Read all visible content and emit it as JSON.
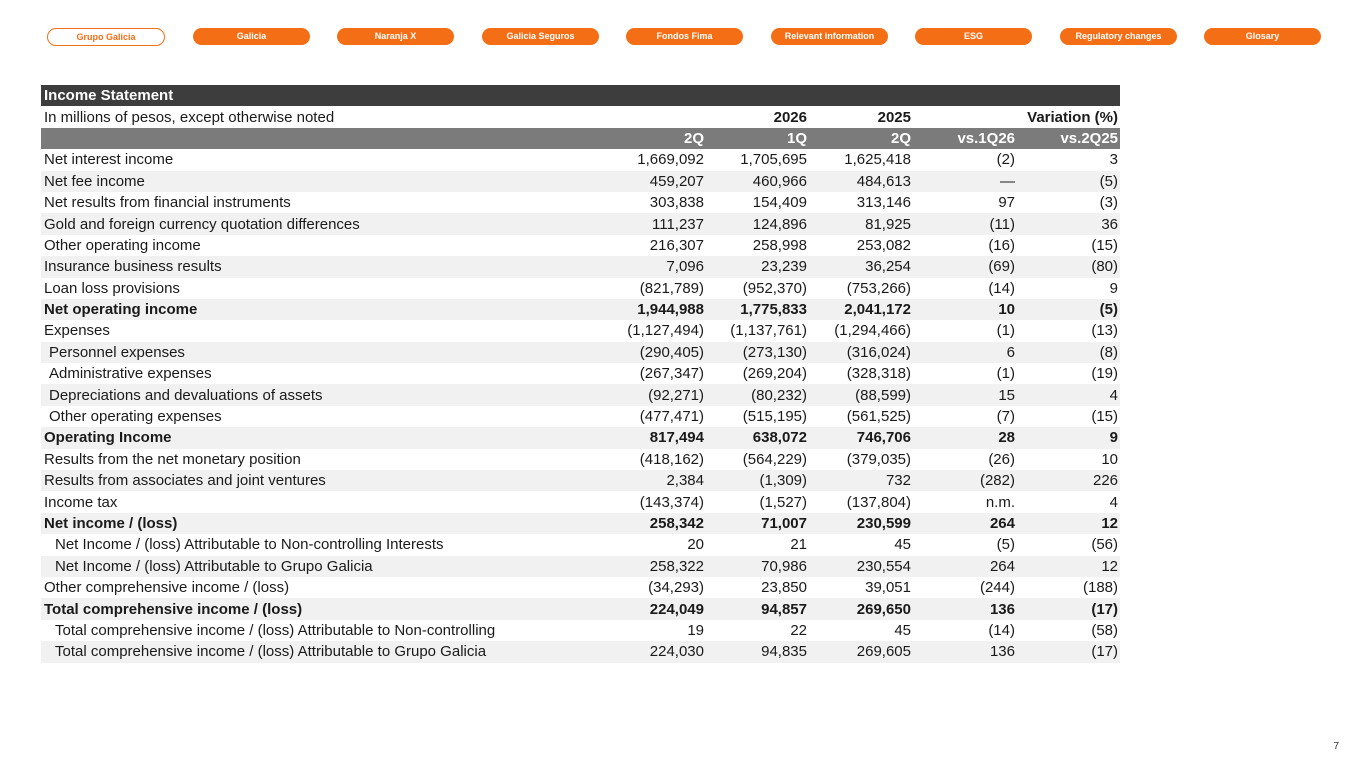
{
  "nav": {
    "items": [
      {
        "label": "Grupo Galicia",
        "active": true
      },
      {
        "label": "Galicia",
        "active": false
      },
      {
        "label": "Naranja X",
        "active": false
      },
      {
        "label": "Galicia Seguros",
        "active": false
      },
      {
        "label": "Fondos Fima",
        "active": false
      },
      {
        "label": "Relevant information",
        "active": false
      },
      {
        "label": "ESG",
        "active": false
      },
      {
        "label": "Regulatory changes",
        "active": false
      },
      {
        "label": "Glosary",
        "active": false
      }
    ]
  },
  "colors": {
    "accent": "#f46e16",
    "header_dark": "#3d3d3d",
    "header_mid": "#7b7b7b",
    "row_shade": "#f1f1f1"
  },
  "table": {
    "title": "Income Statement",
    "subtitle": "In millions of pesos, except otherwise noted",
    "years": [
      "2026",
      "2025"
    ],
    "variation_label": "Variation (%)",
    "columns": [
      "2Q",
      "1Q",
      "2Q",
      "vs.1Q26",
      "vs.2Q25"
    ],
    "rows": [
      {
        "label": "Net interest income",
        "values": [
          "1,669,092",
          "1,705,695",
          "1,625,418",
          "(2)",
          "3"
        ]
      },
      {
        "label": "Net fee income",
        "values": [
          "459,207",
          "460,966",
          "484,613",
          "—",
          "(5)"
        ]
      },
      {
        "label": "Net results from financial instruments",
        "values": [
          "303,838",
          "154,409",
          "313,146",
          "97",
          "(3)"
        ]
      },
      {
        "label": "Gold and foreign currency quotation differences",
        "values": [
          "111,237",
          "124,896",
          "81,925",
          "(11)",
          "36"
        ]
      },
      {
        "label": "Other operating income",
        "values": [
          "216,307",
          "258,998",
          "253,082",
          "(16)",
          "(15)"
        ]
      },
      {
        "label": "Insurance business results",
        "values": [
          "7,096",
          "23,239",
          "36,254",
          "(69)",
          "(80)"
        ]
      },
      {
        "label": "Loan loss provisions",
        "values": [
          "(821,789)",
          "(952,370)",
          "(753,266)",
          "(14)",
          "9"
        ]
      },
      {
        "label": "Net operating income",
        "values": [
          "1,944,988",
          "1,775,833",
          "2,041,172",
          "10",
          "(5)"
        ],
        "bold": true
      },
      {
        "label": "Expenses",
        "values": [
          "(1,127,494)",
          "(1,137,761)",
          "(1,294,466)",
          "(1)",
          "(13)"
        ]
      },
      {
        "label": "Personnel expenses",
        "values": [
          "(290,405)",
          "(273,130)",
          "(316,024)",
          "6",
          "(8)"
        ],
        "indent": 1
      },
      {
        "label": "Administrative expenses",
        "values": [
          "(267,347)",
          "(269,204)",
          "(328,318)",
          "(1)",
          "(19)"
        ],
        "indent": 1
      },
      {
        "label": "Depreciations and devaluations of assets",
        "values": [
          "(92,271)",
          "(80,232)",
          "(88,599)",
          "15",
          "4"
        ],
        "indent": 1
      },
      {
        "label": "Other operating expenses",
        "values": [
          "(477,471)",
          "(515,195)",
          "(561,525)",
          "(7)",
          "(15)"
        ],
        "indent": 1
      },
      {
        "label": "Operating Income",
        "values": [
          "817,494",
          "638,072",
          "746,706",
          "28",
          "9"
        ],
        "bold": true
      },
      {
        "label": "Results from the net monetary position",
        "values": [
          "(418,162)",
          "(564,229)",
          "(379,035)",
          "(26)",
          "10"
        ]
      },
      {
        "label": "Results from associates and joint ventures",
        "values": [
          "2,384",
          "(1,309)",
          "732",
          "(282)",
          "226"
        ]
      },
      {
        "label": "Income tax",
        "values": [
          "(143,374)",
          "(1,527)",
          "(137,804)",
          "n.m.",
          "4"
        ]
      },
      {
        "label": "Net income / (loss)",
        "values": [
          "258,342",
          "71,007",
          "230,599",
          "264",
          "12"
        ],
        "bold": true
      },
      {
        "label": "Net Income / (loss) Attributable to Non-controlling Interests",
        "values": [
          "20",
          "21",
          "45",
          "(5)",
          "(56)"
        ],
        "indent": 2
      },
      {
        "label": "Net Income / (loss) Attributable to Grupo Galicia",
        "values": [
          "258,322",
          "70,986",
          "230,554",
          "264",
          "12"
        ],
        "indent": 2
      },
      {
        "label": "Other comprehensive income / (loss)",
        "values": [
          "(34,293)",
          "23,850",
          "39,051",
          "(244)",
          "(188)"
        ]
      },
      {
        "label": "Total comprehensive income / (loss)",
        "values": [
          "224,049",
          "94,857",
          "269,650",
          "136",
          "(17)"
        ],
        "bold": true
      },
      {
        "label": "Total comprehensive income / (loss) Attributable to Non-controlling",
        "values": [
          "19",
          "22",
          "45",
          "(14)",
          "(58)"
        ],
        "indent": 2
      },
      {
        "label": "Total comprehensive income / (loss) Attributable to Grupo Galicia",
        "values": [
          "224,030",
          "94,835",
          "269,605",
          "136",
          "(17)"
        ],
        "indent": 2
      }
    ]
  },
  "page_number": "7"
}
